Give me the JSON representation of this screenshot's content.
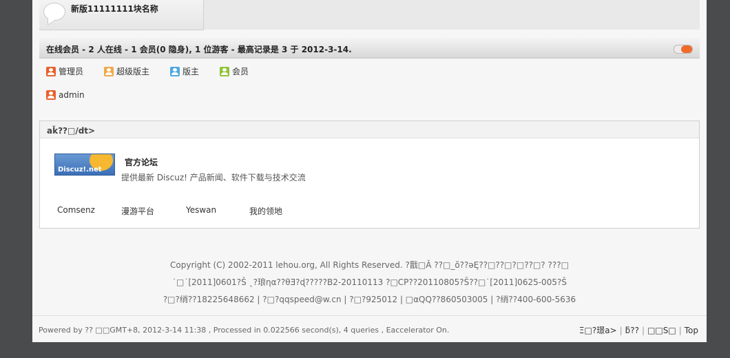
{
  "forum_block": {
    "name": "新版11111111块名称"
  },
  "online": {
    "summary": "在线会员 - 2 人在线 - 1 会员(0 隐身), 1 位游客 - 最高记录是 3 于 2012-3-14.",
    "legend": [
      {
        "label": "管理员",
        "icon": "admin-user-icon",
        "color": "#e8612c"
      },
      {
        "label": "超级版主",
        "icon": "super-moderator-user-icon",
        "color": "#f0a84a"
      },
      {
        "label": "版主",
        "icon": "moderator-user-icon",
        "color": "#4fa8e0"
      },
      {
        "label": "会员",
        "icon": "member-user-icon",
        "color": "#8fc43a"
      }
    ],
    "users": [
      {
        "name": "admin",
        "icon": "admin-user-icon"
      }
    ]
  },
  "links": {
    "header": "aǩ??□/dt>",
    "featured": {
      "logo_text": "Discuz!.net",
      "title": "官方论坛",
      "description": "提供最新 Discuz! 产品新闻、软件下载与技术交流"
    },
    "text_links": [
      "Comsenz",
      "漫游平台",
      "Yeswan",
      "我的领地"
    ]
  },
  "copyright": {
    "line1": "Copyright (C) 2002-2011 lehou.org, All Rights Reserved. ?戬□Ǎ ??□_ŏ??ǝĘ??□??□?□??□?    ???□",
    "line2": "˙□˙[2011]0601?Š  ˛?琅ηα??θƎ?ɖ?????B2-20110113 ?□CP??20110805?Š??□˙[2011]0625-005?Š",
    "line3": "?□?绡??18225648662 | ?□?qqspeed@w.cn | ?□?925012 | □αQQ??860503005 | ?绡??400-600-5636"
  },
  "footer": {
    "powered": "Powered by ??   □□GMT+8, 2012-3-14 11:38 , Processed in 0.022566 second(s), 4 queries , Eaccelerator On.",
    "links": [
      "Ξ□?璟a>",
      "ƃ??",
      "□□S□",
      "Top"
    ]
  }
}
